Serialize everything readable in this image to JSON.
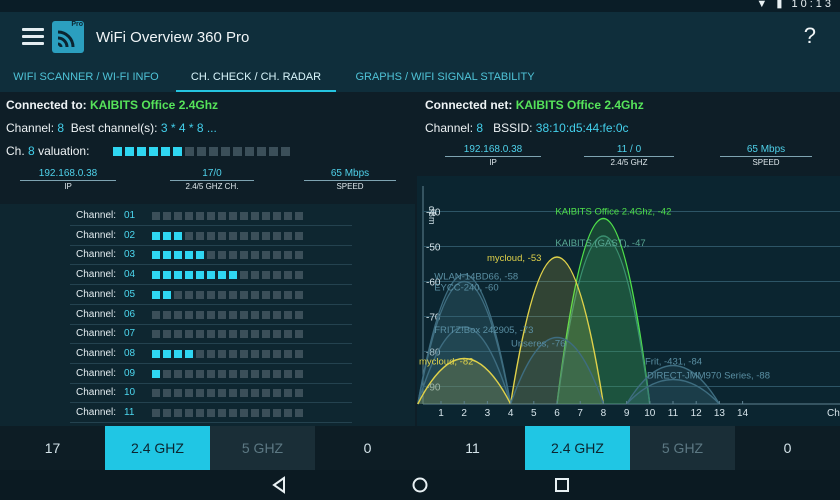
{
  "status_icons": "▼ ▮ 10:13",
  "app": {
    "title": "WiFi Overview 360 Pro",
    "logo_badge": "Pro",
    "help": "?"
  },
  "tabs": [
    {
      "label": "WIFI SCANNER / WI-FI INFO",
      "active": false
    },
    {
      "label": "CH. CHECK / CH. RADAR",
      "active": true
    },
    {
      "label": "GRAPHS / WIFI SIGNAL STABILITY",
      "active": false
    }
  ],
  "left": {
    "connected_label": "Connected to:",
    "connected_value": "KAIBITS Office 2.4Ghz",
    "channel_label": "Channel:",
    "channel_value": "8",
    "best_label": "Best channel(s):",
    "best_value": "3 * 4 * 8 ...",
    "ch_label": "Ch.",
    "ch_value": "8",
    "valuation_label": "valuation:",
    "valuation_level": 0.4,
    "metrics": [
      {
        "value": "192.168.0.38",
        "label": "IP"
      },
      {
        "value": "17/0",
        "label": "2.4/5 GHZ CH."
      },
      {
        "value": "65 Mbps",
        "label": "SPEED"
      }
    ],
    "channel_label_text": "Channel:",
    "channels": [
      {
        "num": "01",
        "level": 0
      },
      {
        "num": "02",
        "level": 3
      },
      {
        "num": "03",
        "level": 5
      },
      {
        "num": "04",
        "level": 8
      },
      {
        "num": "05",
        "level": 2
      },
      {
        "num": "06",
        "level": 0
      },
      {
        "num": "07",
        "level": 0
      },
      {
        "num": "08",
        "level": 4
      },
      {
        "num": "09",
        "level": 1
      },
      {
        "num": "10",
        "level": 0
      },
      {
        "num": "11",
        "level": 0
      }
    ]
  },
  "right": {
    "connected_label": "Connected net:",
    "connected_value": "KAIBITS Office 2.4Ghz",
    "channel_label": "Channel:",
    "channel_value": "8",
    "bssid_label": "BSSID:",
    "bssid_value": "38:10:d5:44:fe:0c",
    "metrics": [
      {
        "value": "192.168.0.38",
        "label": "IP"
      },
      {
        "value": "11 / 0",
        "label": "2.4/5 GHZ"
      },
      {
        "value": "65 Mbps",
        "label": "SPEED"
      }
    ]
  },
  "chart_data": {
    "type": "area",
    "ylabel": "dBm",
    "y_ticks": [
      "-40",
      "-50",
      "-60",
      "-70",
      "-80",
      "-90"
    ],
    "x_ticks": [
      "1",
      "2",
      "3",
      "4",
      "5",
      "6",
      "7",
      "8",
      "9",
      "10",
      "11",
      "12",
      "13",
      "14"
    ],
    "x_axis_suffix": "Ch",
    "ylim": [
      -95,
      -35
    ],
    "networks": [
      {
        "name": "KAIBITS Office 2.4Ghz, -42",
        "channel": 8,
        "dbm": -42,
        "color": "#4fe04a"
      },
      {
        "name": "KAIBITS (GAST), -47",
        "channel": 8,
        "dbm": -47,
        "color": "#3a8f6f"
      },
      {
        "name": "mycloud, -53",
        "channel": 6,
        "dbm": -53,
        "color": "#e0d24a"
      },
      {
        "name": "WLAN-14BD66, -58",
        "channel": 2,
        "dbm": -58,
        "color": "#3e6d80"
      },
      {
        "name": "EYCC-240, -60",
        "channel": 2,
        "dbm": -60,
        "color": "#3e6d80"
      },
      {
        "name": "FRITZ!Box 242905, -73",
        "channel": 2,
        "dbm": -73,
        "color": "#3e6d80"
      },
      {
        "name": "Unseres, -76",
        "channel": 6,
        "dbm": -76,
        "color": "#3e6d80"
      },
      {
        "name": "mycloud, -82",
        "channel": 2,
        "dbm": -82,
        "color": "#e0d24a"
      },
      {
        "name": "Frit, -431, -84",
        "channel": 11,
        "dbm": -84,
        "color": "#3e6d80"
      },
      {
        "name": "DIRECT-JMM970 Series, -88",
        "channel": 11,
        "dbm": -88,
        "color": "#3e6d80"
      }
    ]
  },
  "bottom_bar": [
    {
      "label": "17",
      "state": "normal"
    },
    {
      "label": "2.4 GHZ",
      "state": "active"
    },
    {
      "label": "5 GHZ",
      "state": "muted"
    },
    {
      "label": "0",
      "state": "normal"
    },
    {
      "label": "11",
      "state": "normal"
    },
    {
      "label": "2.4 GHZ",
      "state": "active"
    },
    {
      "label": "5 GHZ",
      "state": "muted"
    },
    {
      "label": "0",
      "state": "normal"
    }
  ],
  "nav": {
    "back": "back-icon",
    "home": "home-icon",
    "recent": "recent-apps-icon"
  }
}
